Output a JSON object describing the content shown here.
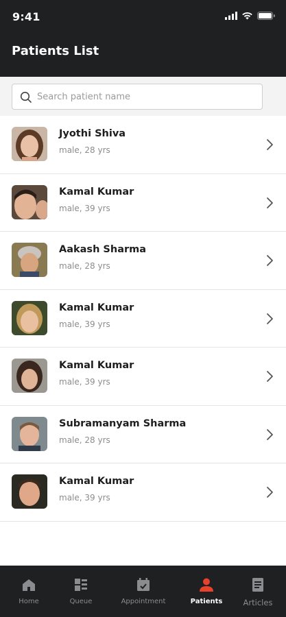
{
  "status_bar": {
    "time": "9:41"
  },
  "header": {
    "title": "Patients List"
  },
  "search": {
    "placeholder": "Search patient name",
    "value": ""
  },
  "patients": [
    {
      "name": "Jyothi Shiva",
      "meta": "male, 28 yrs"
    },
    {
      "name": "Kamal Kumar",
      "meta": "male, 39 yrs"
    },
    {
      "name": "Aakash Sharma",
      "meta": "male, 28 yrs"
    },
    {
      "name": "Kamal Kumar",
      "meta": "male, 39 yrs"
    },
    {
      "name": "Kamal Kumar",
      "meta": "male, 39 yrs"
    },
    {
      "name": "Subramanyam Sharma",
      "meta": "male, 28 yrs"
    },
    {
      "name": "Kamal Kumar",
      "meta": "male, 39 yrs"
    }
  ],
  "tabs": [
    {
      "label": "Home",
      "icon": "home-icon",
      "active": false
    },
    {
      "label": "Queue",
      "icon": "queue-icon",
      "active": false
    },
    {
      "label": "Appointment",
      "icon": "calendar-check-icon",
      "active": false
    },
    {
      "label": "Patients",
      "icon": "person-icon",
      "active": true
    },
    {
      "label": "Articles",
      "icon": "article-icon",
      "active": false
    }
  ],
  "colors": {
    "dark": "#1e2022",
    "accent": "#e8412c",
    "inactive": "#8a8c8f"
  }
}
